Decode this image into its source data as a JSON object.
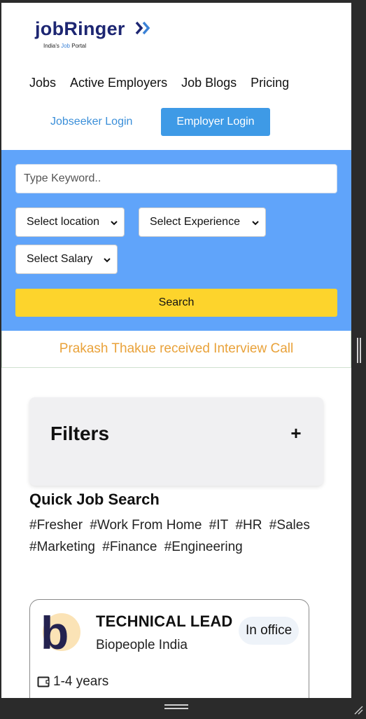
{
  "header": {
    "logo": {
      "brand": "jobRinger",
      "tagline_prefix": "India's ",
      "tagline_highlight": "Job",
      "tagline_suffix": " Portal"
    },
    "nav": [
      {
        "label": "Jobs"
      },
      {
        "label": "Active Employers"
      },
      {
        "label": "Job Blogs"
      },
      {
        "label": "Pricing"
      }
    ],
    "jobseeker_login": "Jobseeker Login",
    "employer_login": "Employer Login"
  },
  "search": {
    "keyword_placeholder": "Type Keyword..",
    "location_selected": "Select location",
    "experience_selected": "Select Experience",
    "salary_selected": "Select Salary",
    "search_button": "Search"
  },
  "notice": "Prakash Thakue received Interview Call",
  "filters": {
    "title": "Filters",
    "toggle": "+"
  },
  "quick_job_search": {
    "title": "Quick Job Search",
    "tags": [
      "#Fresher",
      "#Work From Home",
      "#IT",
      "#HR",
      "#Sales",
      "#Marketing",
      "#Finance",
      "#Engineering"
    ]
  },
  "job_card": {
    "title": "TECHNICAL LEAD",
    "company": "Biopeople India",
    "work_mode": "In office",
    "experience": "1-4 years",
    "logo_letter": "b"
  },
  "colors": {
    "brand_navy": "#1d2672",
    "primary_blue": "#3e9ae6",
    "search_panel": "#60a4fa",
    "search_button": "#fdd42c",
    "notice_text": "#e9a23a"
  }
}
